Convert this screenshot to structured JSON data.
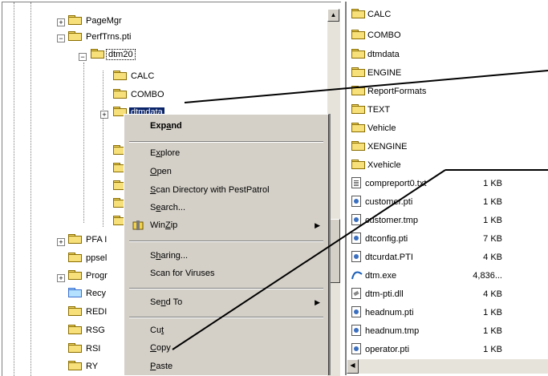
{
  "tree": {
    "nodes": [
      {
        "label": "PageMgr"
      },
      {
        "label": "PerfTrns.pti"
      },
      {
        "label": "dtm20"
      },
      {
        "label": "CALC"
      },
      {
        "label": "COMBO"
      },
      {
        "label": "dtmdata"
      },
      {
        "label": "PFA I"
      },
      {
        "label": "ppsel"
      },
      {
        "label": "Progr"
      },
      {
        "label": "Recy"
      },
      {
        "label": "REDI"
      },
      {
        "label": "RSG"
      },
      {
        "label": "RSI"
      },
      {
        "label": "RY"
      }
    ]
  },
  "context_menu": {
    "expand": {
      "pre": "Exp",
      "u": "a",
      "post": "nd"
    },
    "explore": {
      "pre": "E",
      "u": "x",
      "post": "plore"
    },
    "open": {
      "pre": "",
      "u": "O",
      "post": "pen"
    },
    "scan_pest": {
      "pre": "",
      "u": "S",
      "post": "can Directory with PestPatrol"
    },
    "search": {
      "pre": "S",
      "u": "e",
      "post": "arch..."
    },
    "winzip": {
      "pre": "Win",
      "u": "Z",
      "post": "ip"
    },
    "sharing": {
      "pre": "S",
      "u": "h",
      "post": "aring..."
    },
    "scan_viruses": "Scan for Viruses",
    "send_to": {
      "pre": "Se",
      "u": "n",
      "post": "d To"
    },
    "cut": {
      "pre": "Cu",
      "u": "t",
      "post": ""
    },
    "copy": {
      "pre": "",
      "u": "C",
      "post": "opy"
    },
    "paste": {
      "pre": "",
      "u": "P",
      "post": "aste"
    }
  },
  "list": {
    "folders": [
      "CALC",
      "COMBO",
      "dtmdata",
      "ENGINE",
      "ReportFormats",
      "TEXT",
      "Vehicle",
      "XENGINE",
      "Xvehicle"
    ],
    "files": [
      {
        "name": "compreport0.txt",
        "size": "1 KB",
        "icon": "text-file-icon"
      },
      {
        "name": "customer.pti",
        "size": "1 KB",
        "icon": "pti-file-icon"
      },
      {
        "name": "customer.tmp",
        "size": "1 KB",
        "icon": "pti-file-icon"
      },
      {
        "name": "dtconfig.pti",
        "size": "7 KB",
        "icon": "pti-file-icon"
      },
      {
        "name": "dtcurdat.PTI",
        "size": "4 KB",
        "icon": "pti-file-icon"
      },
      {
        "name": "dtm.exe",
        "size": "4,836...",
        "icon": "exe-file-icon"
      },
      {
        "name": "dtm-pti.dll",
        "size": "4 KB",
        "icon": "dll-file-icon"
      },
      {
        "name": "headnum.pti",
        "size": "1 KB",
        "icon": "pti-file-icon"
      },
      {
        "name": "headnum.tmp",
        "size": "1 KB",
        "icon": "pti-file-icon"
      },
      {
        "name": "operator.pti",
        "size": "1 KB",
        "icon": "pti-file-icon"
      }
    ]
  },
  "colors": {
    "selection": "#0a246a",
    "menu_bg": "#d4d0c8",
    "folder": "#f7e07a"
  }
}
